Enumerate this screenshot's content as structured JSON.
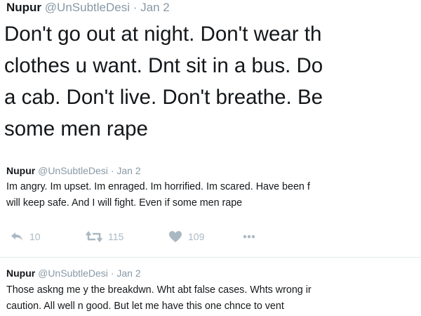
{
  "tweets": [
    {
      "name": "Nupur",
      "handle": "@UnSubtleDesi",
      "separator": "·",
      "date": "Jan 2",
      "lines": [
        "Don't go out at night. Don't wear th",
        "clothes u want. Dnt sit in a bus. Do",
        "a cab. Don't live. Don't breathe. Be",
        "some men rape"
      ]
    },
    {
      "name": "Nupur",
      "handle": "@UnSubtleDesi",
      "separator": "·",
      "date": "Jan 2",
      "lines": [
        "Im angry. Im upset. Im enraged. Im horrified. Im scared. Have been f",
        "will keep safe. And I will fight. Even if some men rape"
      ],
      "actions": {
        "reply_count": "10",
        "retweet_count": "115",
        "like_count": "109",
        "icons": [
          "reply-icon",
          "retweet-icon",
          "heart-icon",
          "more-icon"
        ]
      }
    },
    {
      "name": "Nupur",
      "handle": "@UnSubtleDesi",
      "separator": "·",
      "date": "Jan 2",
      "lines": [
        "Those askng me y the breakdwn. Wht abt false cases. Whts wrong ir",
        "caution. All well n good. But let me have this one chnce to vent"
      ]
    }
  ],
  "colors": {
    "text": "#14171a",
    "meta": "#8899a6",
    "action_icon": "#aab8c2",
    "divider": "#e1e8ed"
  }
}
